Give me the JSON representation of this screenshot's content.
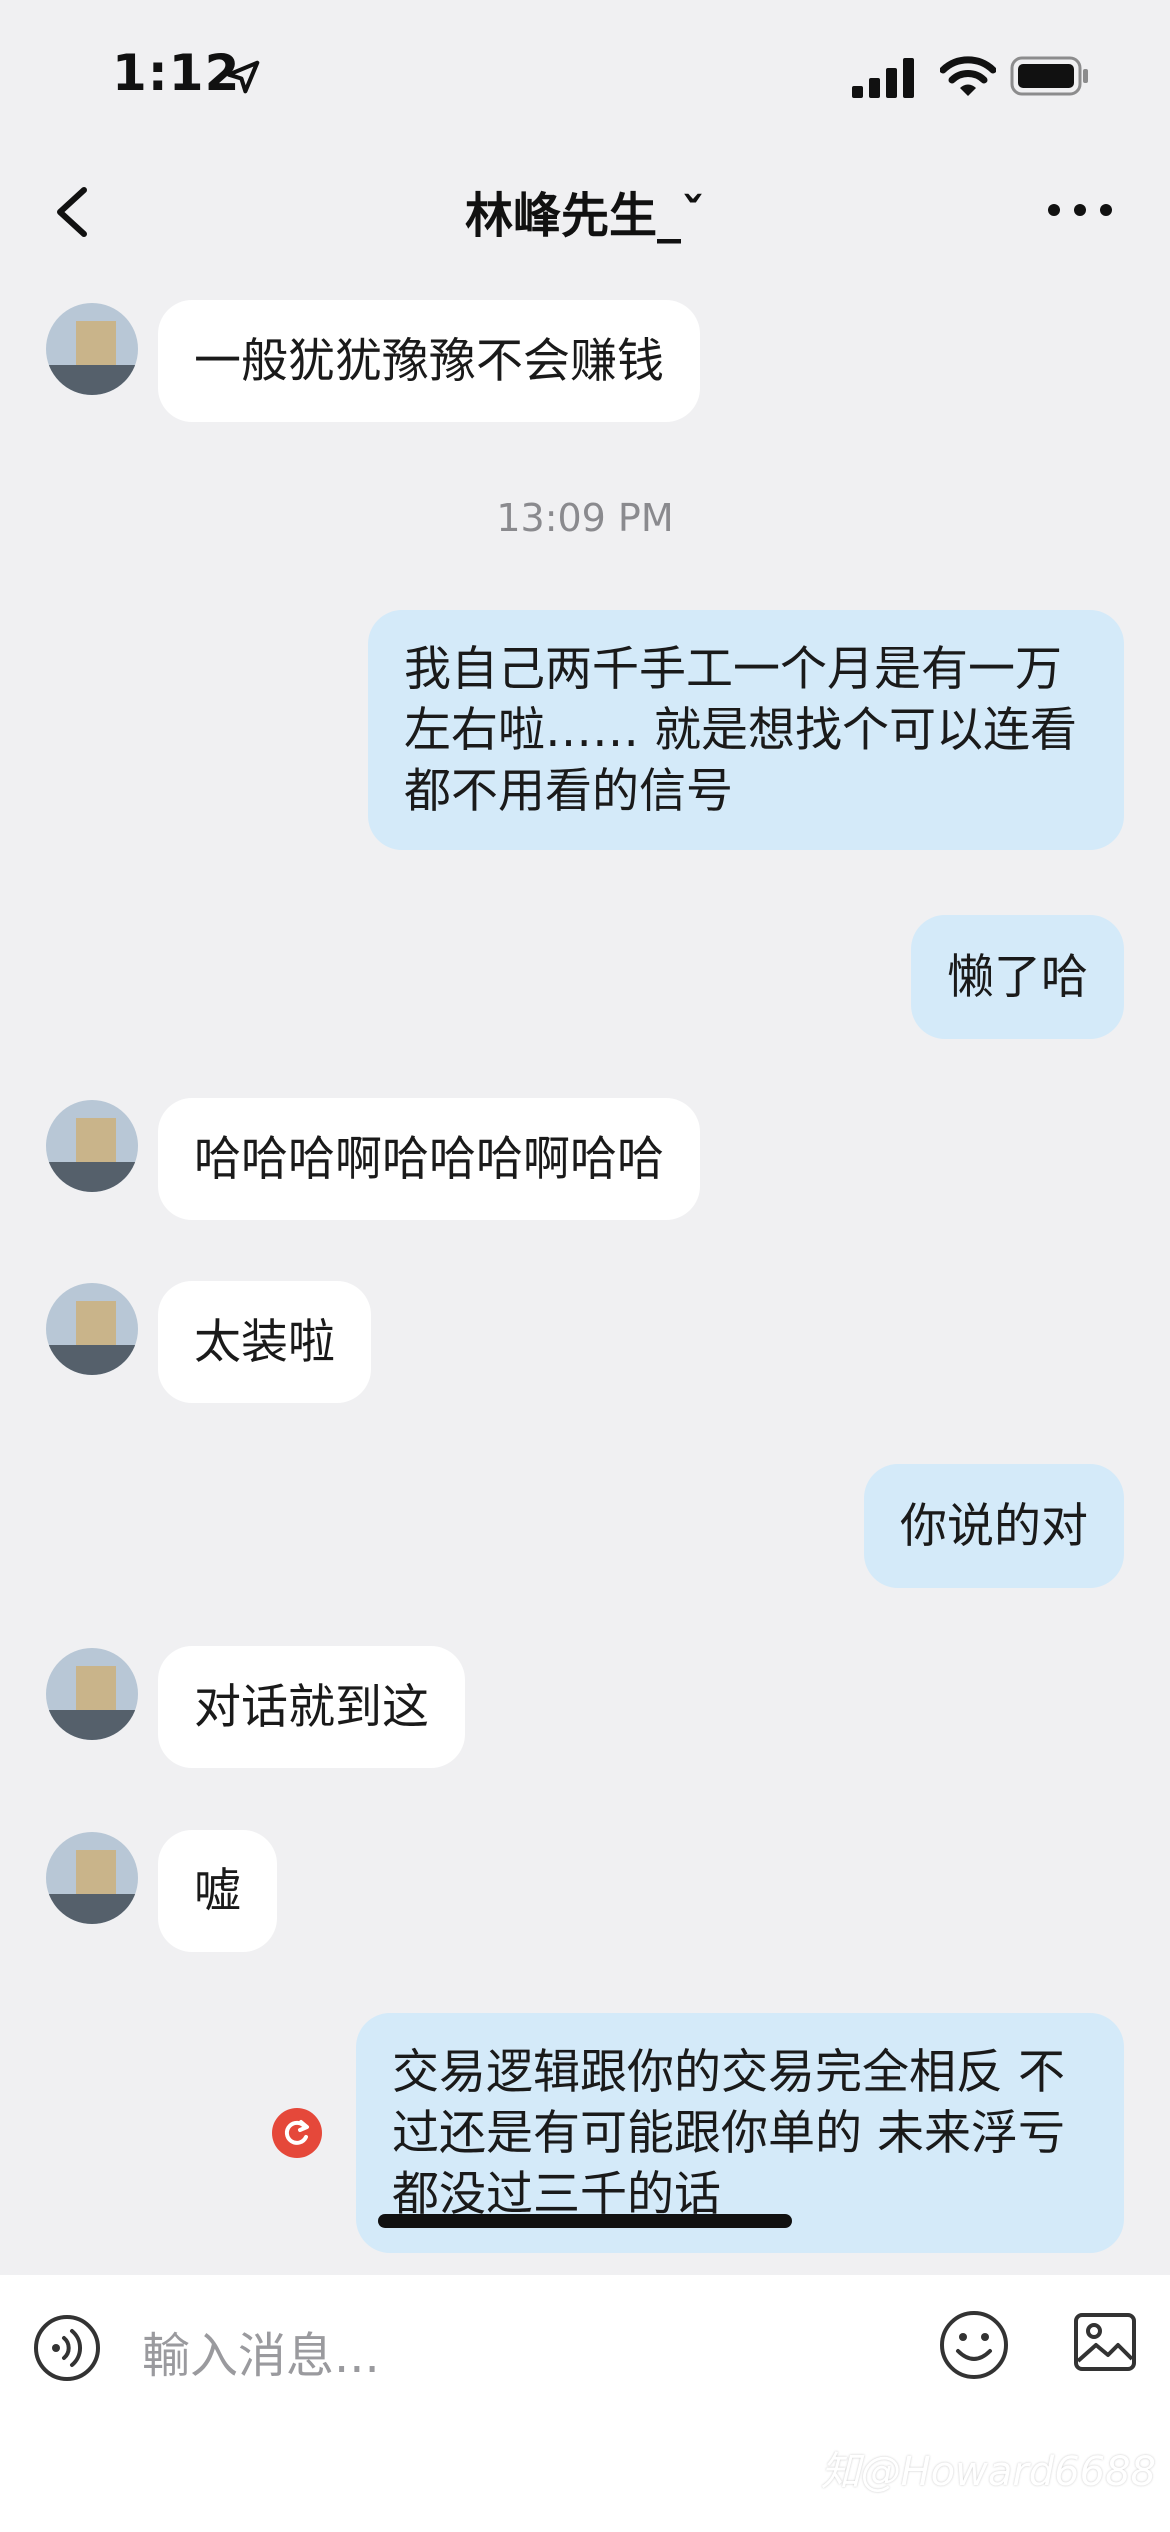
{
  "status_bar": {
    "time": "1:12"
  },
  "header": {
    "title": "林峰先生_ˇ"
  },
  "messages": [
    {
      "side": "in",
      "text": "一般犹犹豫豫不会赚钱"
    },
    {
      "type": "timestamp",
      "text": "13:09 PM"
    },
    {
      "side": "out",
      "text": "我自己两千手工一个月是有一万左右啦…… 就是想找个可以连看都不用看的信号"
    },
    {
      "side": "out",
      "text": "懒了哈"
    },
    {
      "side": "in",
      "text": "哈哈哈啊哈哈哈啊哈哈"
    },
    {
      "side": "in",
      "text": "太装啦"
    },
    {
      "side": "out",
      "text": "你说的对"
    },
    {
      "side": "in",
      "text": "对话就到这"
    },
    {
      "side": "in",
      "text": "嘘"
    },
    {
      "side": "out",
      "text": "交易逻辑跟你的交易完全相反 不过还是有可能跟你单的 未来浮亏都没过三千的话",
      "status": "failed"
    }
  ],
  "input_bar": {
    "placeholder": "輸入消息..."
  },
  "watermark": "知@Howard6688",
  "colors": {
    "outgoing_bubble": "#d4eaf9",
    "incoming_bubble": "#ffffff",
    "failed_icon": "#e5483a"
  },
  "icons": [
    "back-arrow-icon",
    "more-icon",
    "voice-icon",
    "emoji-icon",
    "image-icon",
    "retry-icon",
    "location-arrow-icon",
    "signal-icon",
    "wifi-icon",
    "battery-icon"
  ]
}
